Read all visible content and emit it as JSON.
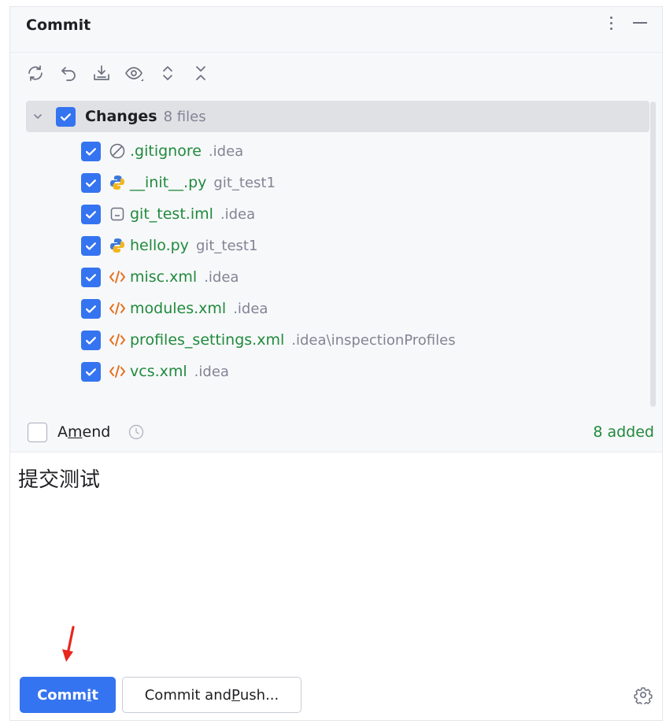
{
  "panel": {
    "title": "Commit"
  },
  "toolbar": {
    "icons": [
      "refresh-icon",
      "rollback-icon",
      "shelve-icon",
      "preview-diff-icon",
      "expand-all-icon",
      "collapse-all-icon"
    ]
  },
  "changes": {
    "label": "Changes",
    "count": "8 files",
    "checked": true,
    "files": [
      {
        "name": ".gitignore",
        "path": ".idea",
        "icon": "ignored-file-icon",
        "checked": true
      },
      {
        "name": "__init__.py",
        "path": "git_test1",
        "icon": "python-file-icon",
        "checked": true
      },
      {
        "name": "git_test.iml",
        "path": ".idea",
        "icon": "iml-file-icon",
        "checked": true
      },
      {
        "name": "hello.py",
        "path": "git_test1",
        "icon": "python-file-icon",
        "checked": true
      },
      {
        "name": "misc.xml",
        "path": ".idea",
        "icon": "xml-file-icon",
        "checked": true
      },
      {
        "name": "modules.xml",
        "path": ".idea",
        "icon": "xml-file-icon",
        "checked": true
      },
      {
        "name": "profiles_settings.xml",
        "path": ".idea\\inspectionProfiles",
        "icon": "xml-file-icon",
        "checked": true
      },
      {
        "name": "vcs.xml",
        "path": ".idea",
        "icon": "xml-file-icon",
        "checked": true
      }
    ]
  },
  "amend": {
    "label_pre": "A",
    "label_mnemonic": "m",
    "label_post": "end",
    "checked": false
  },
  "summary": {
    "added": "8 added"
  },
  "commit_message": {
    "text": "提交测试"
  },
  "buttons": {
    "commit_pre": "Comm",
    "commit_mnemonic": "i",
    "commit_post": "t",
    "push_pre": "Commit and ",
    "push_mnemonic": "P",
    "push_post": "ush..."
  },
  "colors": {
    "accent": "#3574f0",
    "added_green": "#208a3c",
    "xml_orange": "#e66d17",
    "annotation_arrow": "#e8261c"
  }
}
